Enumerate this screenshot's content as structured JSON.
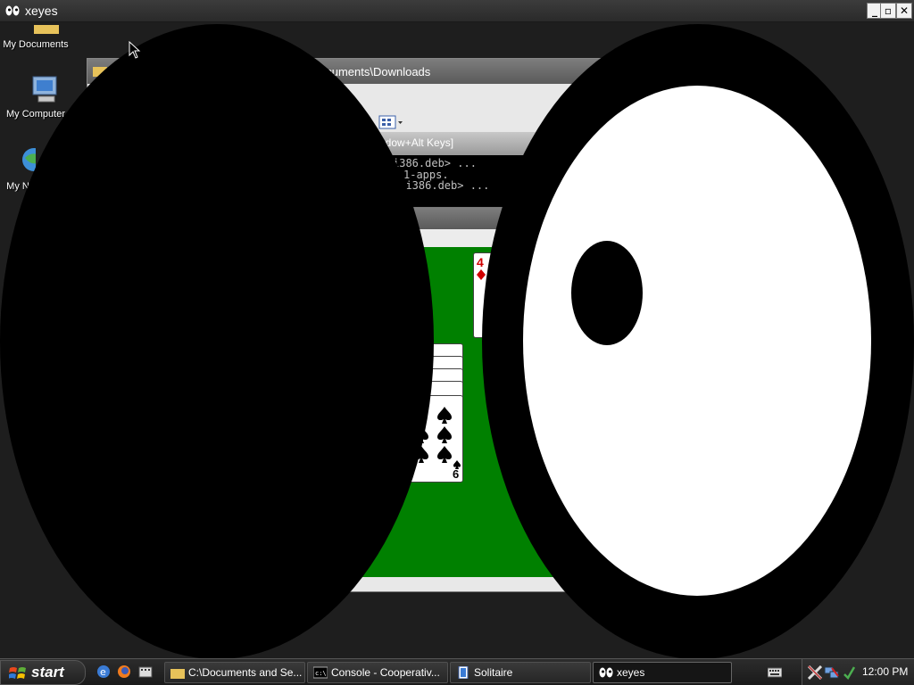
{
  "xeyes": {
    "title": "xeyes",
    "buttons": {
      "minimize": "_",
      "restore": "▫",
      "close": "✕"
    }
  },
  "desktop": {
    "icons": [
      {
        "label": "My Documents",
        "icon": "folder-icon"
      },
      {
        "label": "My Computer",
        "icon": "computer-icon"
      },
      {
        "label": "My N",
        "icon": "network-icon"
      }
    ]
  },
  "explorer": {
    "title": "ocuments\\Downloads"
  },
  "console": {
    "title": "ndow+Alt Keys]",
    "lines": [
      "i386.deb> ...",
      "1-apps.",
      "5_i386.deb> ..."
    ]
  },
  "solitaire": {
    "cards": {
      "top": "4",
      "bottom": "6"
    }
  },
  "taskbar": {
    "start": "start",
    "quick_launch": [
      "ie-icon",
      "firefox-icon",
      "media-icon"
    ],
    "tasks": [
      {
        "label": "C:\\Documents and Se...",
        "icon": "folder-icon"
      },
      {
        "label": "Console - Cooperativ...",
        "icon": "console-icon"
      },
      {
        "label": "Solitaire",
        "icon": "solitaire-icon"
      },
      {
        "label": "xeyes",
        "icon": "eyes-icon"
      }
    ],
    "clock": "12:00 PM"
  }
}
